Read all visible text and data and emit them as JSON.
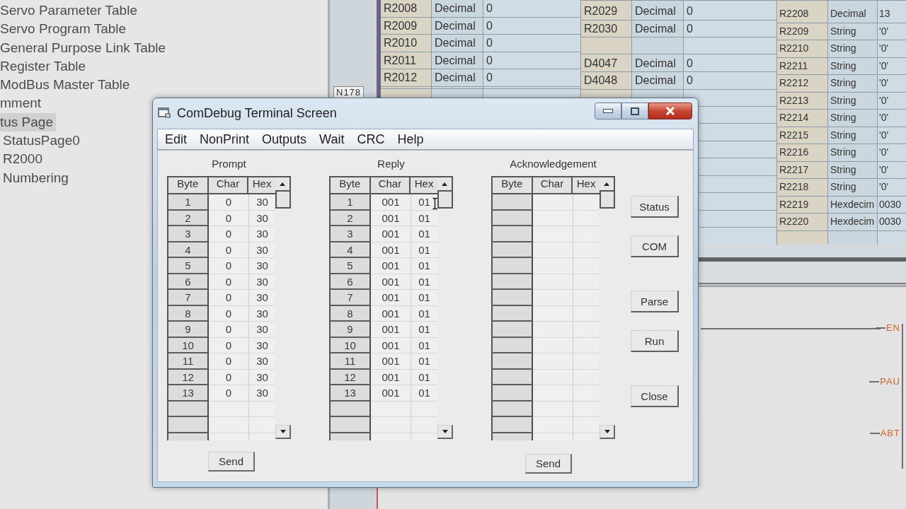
{
  "tree": {
    "items": [
      {
        "label": "Servo Parameter Table",
        "selected": false
      },
      {
        "label": "Servo Program Table",
        "selected": false
      },
      {
        "label": "General Purpose Link Table",
        "selected": false
      },
      {
        "label": "Register Table",
        "selected": false
      },
      {
        "label": "ModBus Master Table",
        "selected": false
      },
      {
        "label": "mment",
        "selected": false
      },
      {
        "label": "tus Page",
        "selected": true,
        "children": [
          {
            "label": "StatusPage0",
            "selected": false
          },
          {
            "label": "R2000",
            "selected": false
          },
          {
            "label": "Numbering",
            "selected": false
          }
        ]
      }
    ]
  },
  "node_label": "N178",
  "register_table": {
    "groups": [
      {
        "rows": [
          [
            "R2008",
            "Decimal",
            "0"
          ],
          [
            "R2009",
            "Decimal",
            "0"
          ],
          [
            "R2010",
            "Decimal",
            "0"
          ],
          [
            "R2011",
            "Decimal",
            "0"
          ],
          [
            "R2012",
            "Decimal",
            "0"
          ]
        ]
      },
      {
        "rows": [
          [
            "R2029",
            "Decimal",
            "0"
          ],
          [
            "R2030",
            "Decimal",
            "0"
          ],
          null,
          [
            "D4047",
            "Decimal",
            "0"
          ],
          [
            "D4048",
            "Decimal",
            "0"
          ]
        ]
      },
      {
        "rows": [
          [
            "R2208",
            "Decimal",
            "13"
          ],
          [
            "R2209",
            "String",
            "'0'"
          ],
          [
            "R2210",
            "String",
            "'0'"
          ],
          [
            "R2211",
            "String",
            "'0'"
          ],
          [
            "R2212",
            "String",
            "'0'"
          ],
          [
            "R2213",
            "String",
            "'0'"
          ],
          [
            "R2214",
            "String",
            "'0'"
          ],
          [
            "R2215",
            "String",
            "'0'"
          ],
          [
            "R2216",
            "String",
            "'0'"
          ],
          [
            "R2217",
            "String",
            "'0'"
          ],
          [
            "R2218",
            "String",
            "'0'"
          ],
          [
            "R2219",
            "Hexdecim",
            "0030"
          ],
          [
            "R2220",
            "Hexdecim",
            "0030"
          ]
        ]
      }
    ]
  },
  "ladder": {
    "pins": [
      "EN",
      "PAU",
      "ABT"
    ]
  },
  "dialog": {
    "title": "ComDebug Terminal Screen",
    "menu": [
      "Edit",
      "NonPrint",
      "Outputs",
      "Wait",
      "CRC",
      "Help"
    ],
    "grids": [
      {
        "label": "Prompt",
        "columns": [
          "Byte",
          "Char",
          "Hex"
        ],
        "rows": [
          [
            "1",
            "0",
            "30"
          ],
          [
            "2",
            "0",
            "30"
          ],
          [
            "3",
            "0",
            "30"
          ],
          [
            "4",
            "0",
            "30"
          ],
          [
            "5",
            "0",
            "30"
          ],
          [
            "6",
            "0",
            "30"
          ],
          [
            "7",
            "0",
            "30"
          ],
          [
            "8",
            "0",
            "30"
          ],
          [
            "9",
            "0",
            "30"
          ],
          [
            "10",
            "0",
            "30"
          ],
          [
            "11",
            "0",
            "30"
          ],
          [
            "12",
            "0",
            "30"
          ],
          [
            "13",
            "0",
            "30"
          ]
        ],
        "send": "Send"
      },
      {
        "label": "Reply",
        "columns": [
          "Byte",
          "Char",
          "Hex"
        ],
        "rows": [
          [
            "1",
            "001",
            "01"
          ],
          [
            "2",
            "001",
            "01"
          ],
          [
            "3",
            "001",
            "01"
          ],
          [
            "4",
            "001",
            "01"
          ],
          [
            "5",
            "001",
            "01"
          ],
          [
            "6",
            "001",
            "01"
          ],
          [
            "7",
            "001",
            "01"
          ],
          [
            "8",
            "001",
            "01"
          ],
          [
            "9",
            "001",
            "01"
          ],
          [
            "10",
            "001",
            "01"
          ],
          [
            "11",
            "001",
            "01"
          ],
          [
            "12",
            "001",
            "01"
          ],
          [
            "13",
            "001",
            "01"
          ]
        ]
      },
      {
        "label": "Acknowledgement",
        "columns": [
          "Byte",
          "Char",
          "Hex"
        ],
        "send": "Send"
      }
    ],
    "buttons": [
      "Status",
      "COM",
      "Parse",
      "Run",
      "Close"
    ]
  }
}
